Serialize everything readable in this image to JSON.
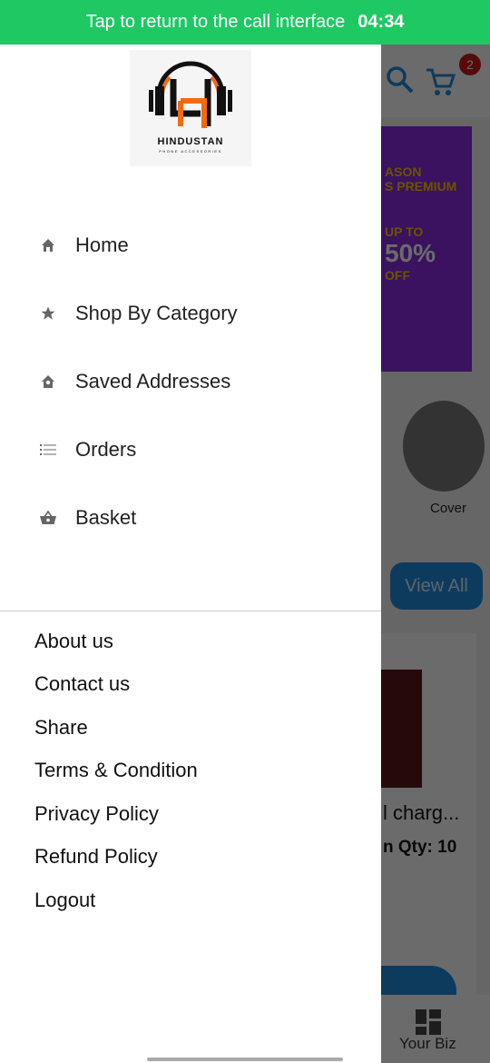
{
  "status_bar": {
    "call_text": "Tap to return to the call interface",
    "time": "04:34"
  },
  "background": {
    "cart_badge": "2",
    "banner": {
      "line1": "ASON",
      "line2": "S PREMIUM",
      "line3": "UP TO",
      "line4": "50%",
      "line5": "OFF"
    },
    "category_label": "Cover",
    "view_all": "View All",
    "product_name": "l charg...",
    "product_qty": "n Qty: 10",
    "bottom_nav_label": "Your Biz"
  },
  "drawer": {
    "logo": {
      "brand": "HINDUSTAN",
      "tagline": "PHONE ACCESSORIES",
      "colors": {
        "orange": "#f26a10",
        "black": "#111111"
      }
    },
    "menu": [
      {
        "label": "Home",
        "icon": "home-icon"
      },
      {
        "label": "Shop By Category",
        "icon": "star-icon"
      },
      {
        "label": "Saved Addresses",
        "icon": "location-home-icon"
      },
      {
        "label": "Orders",
        "icon": "list-icon"
      },
      {
        "label": "Basket",
        "icon": "basket-icon"
      }
    ],
    "links": [
      "About us",
      "Contact us",
      "Share",
      "Terms & Condition",
      "Privacy Policy",
      "Refund Policy",
      "Logout"
    ]
  },
  "colors": {
    "status_green": "#1ec863",
    "accent_blue": "#1e8de0",
    "badge_red": "#d01818"
  }
}
